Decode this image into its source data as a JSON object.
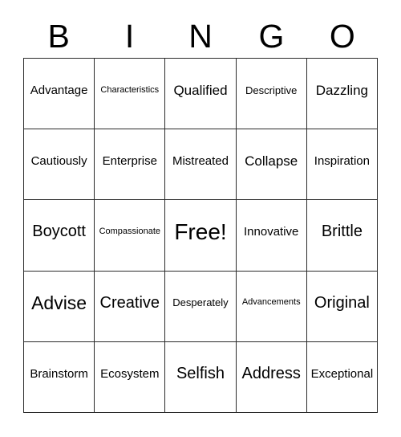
{
  "card": {
    "title": "BINGO",
    "header_letters": [
      "B",
      "I",
      "N",
      "G",
      "O"
    ],
    "columns": 5,
    "rows": 5,
    "free_space_label": "Free!",
    "free_space_position": "center",
    "background_color": "#ffffff",
    "border_color": "#2b2b2b",
    "text_color": "#000000"
  },
  "grid": {
    "rows": [
      {
        "cells": [
          {
            "label": "Advantage",
            "size": "m",
            "free": false
          },
          {
            "label": "Characteristics",
            "size": "xs",
            "free": false
          },
          {
            "label": "Qualified",
            "size": "l",
            "free": false
          },
          {
            "label": "Descriptive",
            "size": "s",
            "free": false
          },
          {
            "label": "Dazzling",
            "size": "l",
            "free": false
          }
        ]
      },
      {
        "cells": [
          {
            "label": "Cautiously",
            "size": "m",
            "free": false
          },
          {
            "label": "Enterprise",
            "size": "m",
            "free": false
          },
          {
            "label": "Mistreated",
            "size": "m",
            "free": false
          },
          {
            "label": "Collapse",
            "size": "l",
            "free": false
          },
          {
            "label": "Inspiration",
            "size": "m",
            "free": false
          }
        ]
      },
      {
        "cells": [
          {
            "label": "Boycott",
            "size": "xl",
            "free": false
          },
          {
            "label": "Compassionate",
            "size": "xs",
            "free": false
          },
          {
            "label": "Free!",
            "size": "free",
            "free": true
          },
          {
            "label": "Innovative",
            "size": "m",
            "free": false
          },
          {
            "label": "Brittle",
            "size": "xl",
            "free": false
          }
        ]
      },
      {
        "cells": [
          {
            "label": "Advise",
            "size": "xxl",
            "free": false
          },
          {
            "label": "Creative",
            "size": "xl",
            "free": false
          },
          {
            "label": "Desperately",
            "size": "s",
            "free": false
          },
          {
            "label": "Advancements",
            "size": "xs",
            "free": false
          },
          {
            "label": "Original",
            "size": "xl",
            "free": false
          }
        ]
      },
      {
        "cells": [
          {
            "label": "Brainstorm",
            "size": "m",
            "free": false
          },
          {
            "label": "Ecosystem",
            "size": "m",
            "free": false
          },
          {
            "label": "Selfish",
            "size": "xl",
            "free": false
          },
          {
            "label": "Address",
            "size": "xl",
            "free": false
          },
          {
            "label": "Exceptional",
            "size": "m",
            "free": false
          }
        ]
      }
    ]
  }
}
